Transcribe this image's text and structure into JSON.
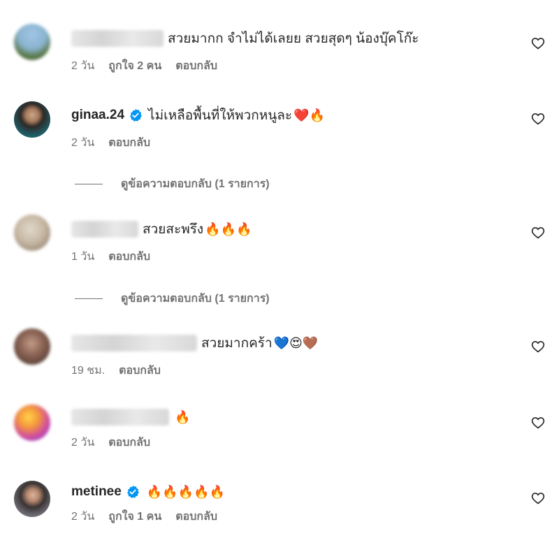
{
  "comments": [
    {
      "username": "",
      "text": "สวยมากก จำไม่ได้เลยย สวยสุดๆ น้องบุ๊คโก๊ะ",
      "emojis": "",
      "time": "2 วัน",
      "likes": "ถูกใจ 2 คน",
      "reply": "ตอบกลับ"
    },
    {
      "username": "ginaa.24",
      "text": "ไม่เหลือพื้นที่ให้พวกหนูละ",
      "emojis": "❤️🔥",
      "time": "2 วัน",
      "likes": "",
      "reply": "ตอบกลับ"
    },
    {
      "username": "",
      "text": "สวยสะพรึง",
      "emojis": "🔥🔥🔥",
      "time": "1 วัน",
      "likes": "",
      "reply": "ตอบกลับ"
    },
    {
      "username": "",
      "text": "สวยมากคร้า",
      "emojis": "💙😍🤎",
      "time": "19 ชม.",
      "likes": "",
      "reply": "ตอบกลับ"
    },
    {
      "username": "",
      "text": "",
      "emojis": "🔥",
      "time": "2 วัน",
      "likes": "",
      "reply": "ตอบกลับ"
    },
    {
      "username": "metinee",
      "text": "",
      "emojis": "🔥🔥🔥🔥🔥",
      "time": "2 วัน",
      "likes": "ถูกใจ 1 คน",
      "reply": "ตอบกลับ"
    }
  ],
  "view_replies": [
    {
      "label": "ดูข้อความตอบกลับ (1 รายการ)"
    },
    {
      "label": "ดูข้อความตอบกลับ (1 รายการ)"
    }
  ],
  "icons": {
    "like": "heart-outline-icon",
    "verified": "verified-badge-icon"
  },
  "colors": {
    "primary_text": "#262626",
    "secondary_text": "#737373",
    "verified_blue": "#0095f6"
  }
}
